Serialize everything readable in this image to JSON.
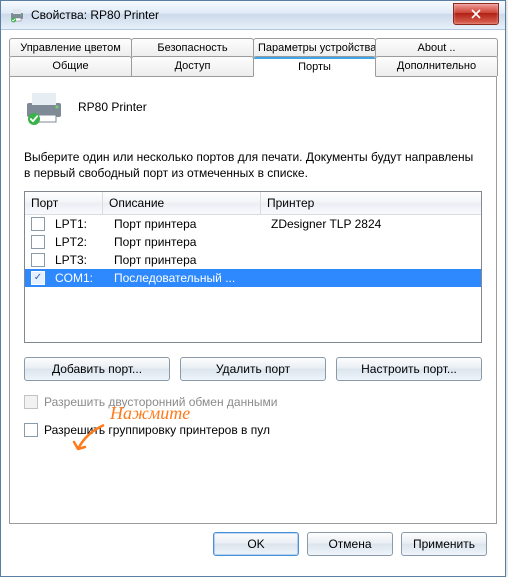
{
  "window": {
    "title": "Свойства: RP80 Printer"
  },
  "tabs_row1": [
    {
      "label": "Управление цветом"
    },
    {
      "label": "Безопасность"
    },
    {
      "label": "Параметры устройства"
    },
    {
      "label": "About .."
    }
  ],
  "tabs_row2": [
    {
      "label": "Общие"
    },
    {
      "label": "Доступ"
    },
    {
      "label": "Порты"
    },
    {
      "label": "Дополнительно"
    }
  ],
  "printer": {
    "name": "RP80 Printer"
  },
  "description": "Выберите один или несколько портов для печати. Документы будут направлены в первый свободный порт из отмеченных в списке.",
  "columns": {
    "port": "Порт",
    "desc": "Описание",
    "prn": "Принтер"
  },
  "rows": [
    {
      "checked": false,
      "port": "LPT1:",
      "desc": "Порт принтера",
      "prn": "ZDesigner TLP 2824"
    },
    {
      "checked": false,
      "port": "LPT2:",
      "desc": "Порт принтера",
      "prn": ""
    },
    {
      "checked": false,
      "port": "LPT3:",
      "desc": "Порт принтера",
      "prn": ""
    },
    {
      "checked": true,
      "port": "COM1:",
      "desc": "Последовательный ...",
      "prn": ""
    }
  ],
  "buttons": {
    "add": "Добавить порт...",
    "del": "Удалить порт",
    "cfg": "Настроить порт..."
  },
  "checks": {
    "bidi": "Разрешить двусторонний обмен данными",
    "pool": "Разрешить группировку принтеров в пул"
  },
  "footer": {
    "ok": "OK",
    "cancel": "Отмена",
    "apply": "Применить"
  },
  "annotation": "Нажмите"
}
